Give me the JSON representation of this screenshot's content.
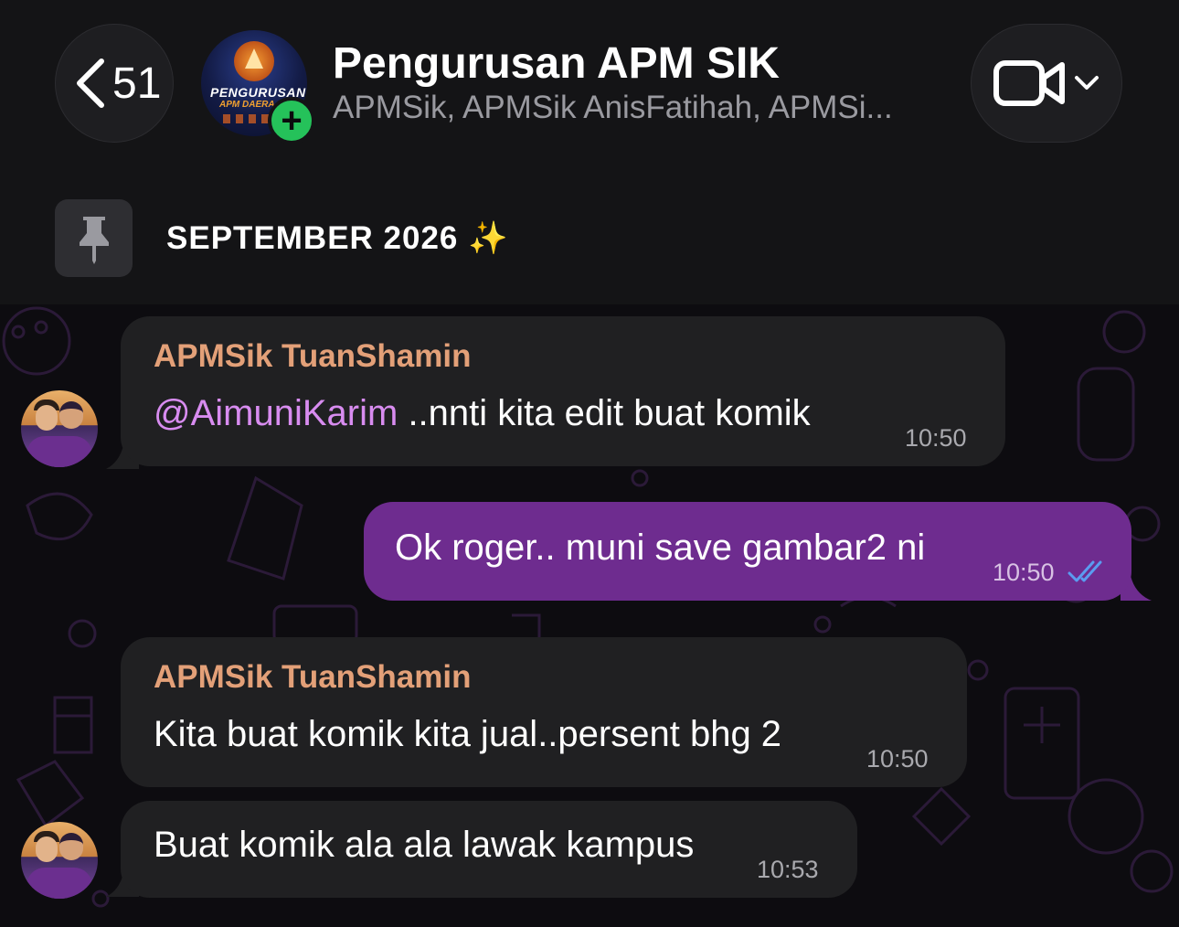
{
  "header": {
    "back_count": "51",
    "title": "Pengurusan APM SIK",
    "members": "APMSik, APMSik AnisFatihah, APMSi...",
    "avatar_text_line1": "PENGURUSAN",
    "avatar_text_line2": "APM DAERA",
    "back_icon": "chevron-left-icon",
    "video_icon": "video-camera-icon",
    "add_badge_icon": "plus-icon"
  },
  "pinned": {
    "text": "SEPTEMBER 2026 ✨",
    "icon": "pin-icon"
  },
  "messages": [
    {
      "direction": "incoming",
      "sender": "APMSik TuanShamin",
      "mention": "@AimuniKarim",
      "text": " ..nnti kita edit buat komik",
      "time": "10:50"
    },
    {
      "direction": "outgoing",
      "text": "Ok roger.. muni save gambar2 ni",
      "time": "10:50",
      "status_icon": "double-check-icon"
    },
    {
      "direction": "incoming",
      "sender": "APMSik TuanShamin",
      "text": "Kita buat komik kita jual..persent bhg 2",
      "time": "10:50"
    },
    {
      "direction": "incoming",
      "text": "Buat komik ala ala lawak kampus",
      "time": "10:53"
    }
  ],
  "colors": {
    "background": "#0d0c10",
    "header": "#141416",
    "incoming_bubble": "#202022",
    "outgoing_bubble": "#6e2c8f",
    "sender_name": "#e3a078",
    "mention": "#d88cf0",
    "read_check": "#5a9cf0",
    "add_badge": "#25c25a"
  }
}
